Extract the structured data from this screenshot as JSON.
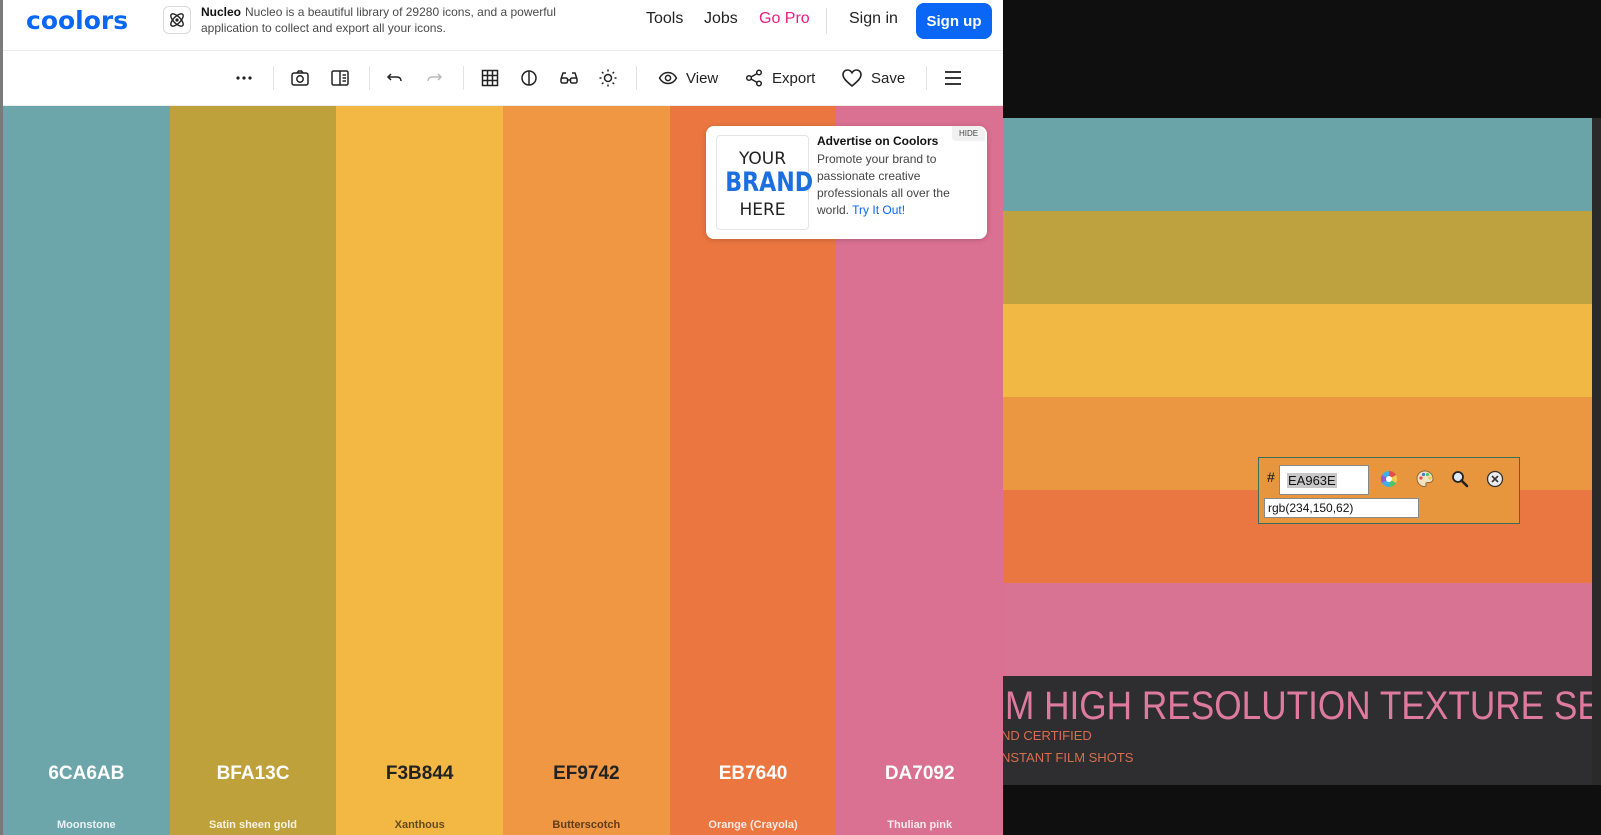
{
  "header": {
    "logo": "coolors",
    "ad_brand": "Nucleo",
    "ad_text": "Nucleo is a beautiful library of 29280 icons, and a powerful application to collect and export all your icons.",
    "nav": {
      "tools": "Tools",
      "jobs": "Jobs",
      "go_pro": "Go Pro",
      "sign_in": "Sign in",
      "sign_up": "Sign up"
    }
  },
  "toolbar": {
    "icons": [
      "more-icon",
      "camera-icon",
      "split-view-icon",
      "undo-icon",
      "redo-icon",
      "grid-icon",
      "contrast-icon",
      "glasses-icon",
      "brightness-icon"
    ],
    "view_label": "View",
    "export_label": "Export",
    "save_label": "Save",
    "menu_icon": "menu-icon"
  },
  "palette": [
    {
      "hex": "6CA6AB",
      "name": "Moonstone",
      "color": "#6CA6AB",
      "text_color": "#ffffff"
    },
    {
      "hex": "BFA13C",
      "name": "Satin sheen gold",
      "color": "#BFA13C",
      "text_color": "#ffffff"
    },
    {
      "hex": "F3B844",
      "name": "Xanthous",
      "color": "#F3B844",
      "text_color": "#222222"
    },
    {
      "hex": "EF9742",
      "name": "Butterscotch",
      "color": "#EF9742",
      "text_color": "#222222"
    },
    {
      "hex": "EB7640",
      "name": "Orange (Crayola)",
      "color": "#EB7640",
      "text_color": "#ffffff"
    },
    {
      "hex": "DA7092",
      "name": "Thulian pink",
      "color": "#DA7092",
      "text_color": "#ffffff"
    }
  ],
  "advert": {
    "brand_line1": "YOUR",
    "brand_line2": "BRAND",
    "brand_line3": "HERE",
    "title": "Advertise on Coolors",
    "body": "Promote your brand to passionate creative professionals all over the world.",
    "link": "Try It Out!",
    "hide": "HIDE"
  },
  "texture": {
    "bands": [
      "#6aa3a8",
      "#bea23f",
      "#f1b843",
      "#eb9640",
      "#ea7641",
      "#d97394",
      "#2e2e30"
    ],
    "title": "M HIGH RESOLUTION TEXTURE SET",
    "sub1": "ND CERTIFIED",
    "sub2": "NSTANT FILM SHOTS"
  },
  "picker": {
    "hash": "#",
    "hex": "EA963E",
    "rgb": "rgb(234,150,62)",
    "icons": [
      "color-wheel-icon",
      "palette-icon",
      "magnifier-icon",
      "close-icon"
    ]
  }
}
